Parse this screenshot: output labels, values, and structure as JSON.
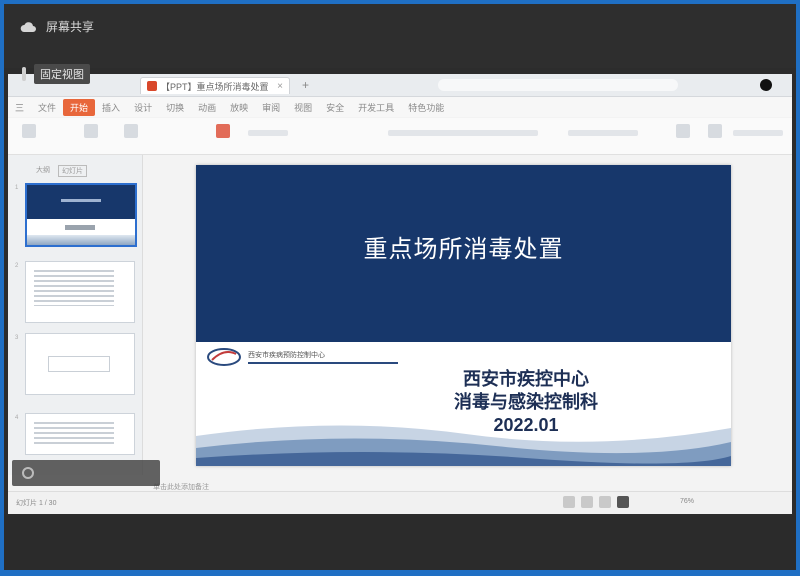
{
  "overlay": {
    "share_label": "屏幕共享",
    "pin_label": "固定视图"
  },
  "doc_tab": {
    "title": "【PPT】重点场所消毒处置",
    "close": "×"
  },
  "menu": [
    "三",
    "文件",
    "开始",
    "插入",
    "设计",
    "切换",
    "动画",
    "放映",
    "审阅",
    "视图",
    "安全",
    "开发工具",
    "特色功能"
  ],
  "menu_active_index": 2,
  "sidebar": {
    "tabs": [
      "大纲",
      "幻灯片"
    ],
    "slide_numbers": [
      "1",
      "2",
      "3",
      "4"
    ]
  },
  "slide": {
    "title": "重点场所消毒处置",
    "org_line1": "西安市疾控中心",
    "org_line2": "消毒与感染控制科",
    "date": "2022.01",
    "logo_text": "西安市疾病预防控制中心"
  },
  "status": {
    "left": "幻灯片 1 / 30",
    "notes_hint": "单击此处添加备注",
    "zoom": "76%"
  },
  "colors": {
    "slide_blue": "#17376b",
    "accent_orange": "#e8673b",
    "frame_blue": "#1f6fc4"
  }
}
